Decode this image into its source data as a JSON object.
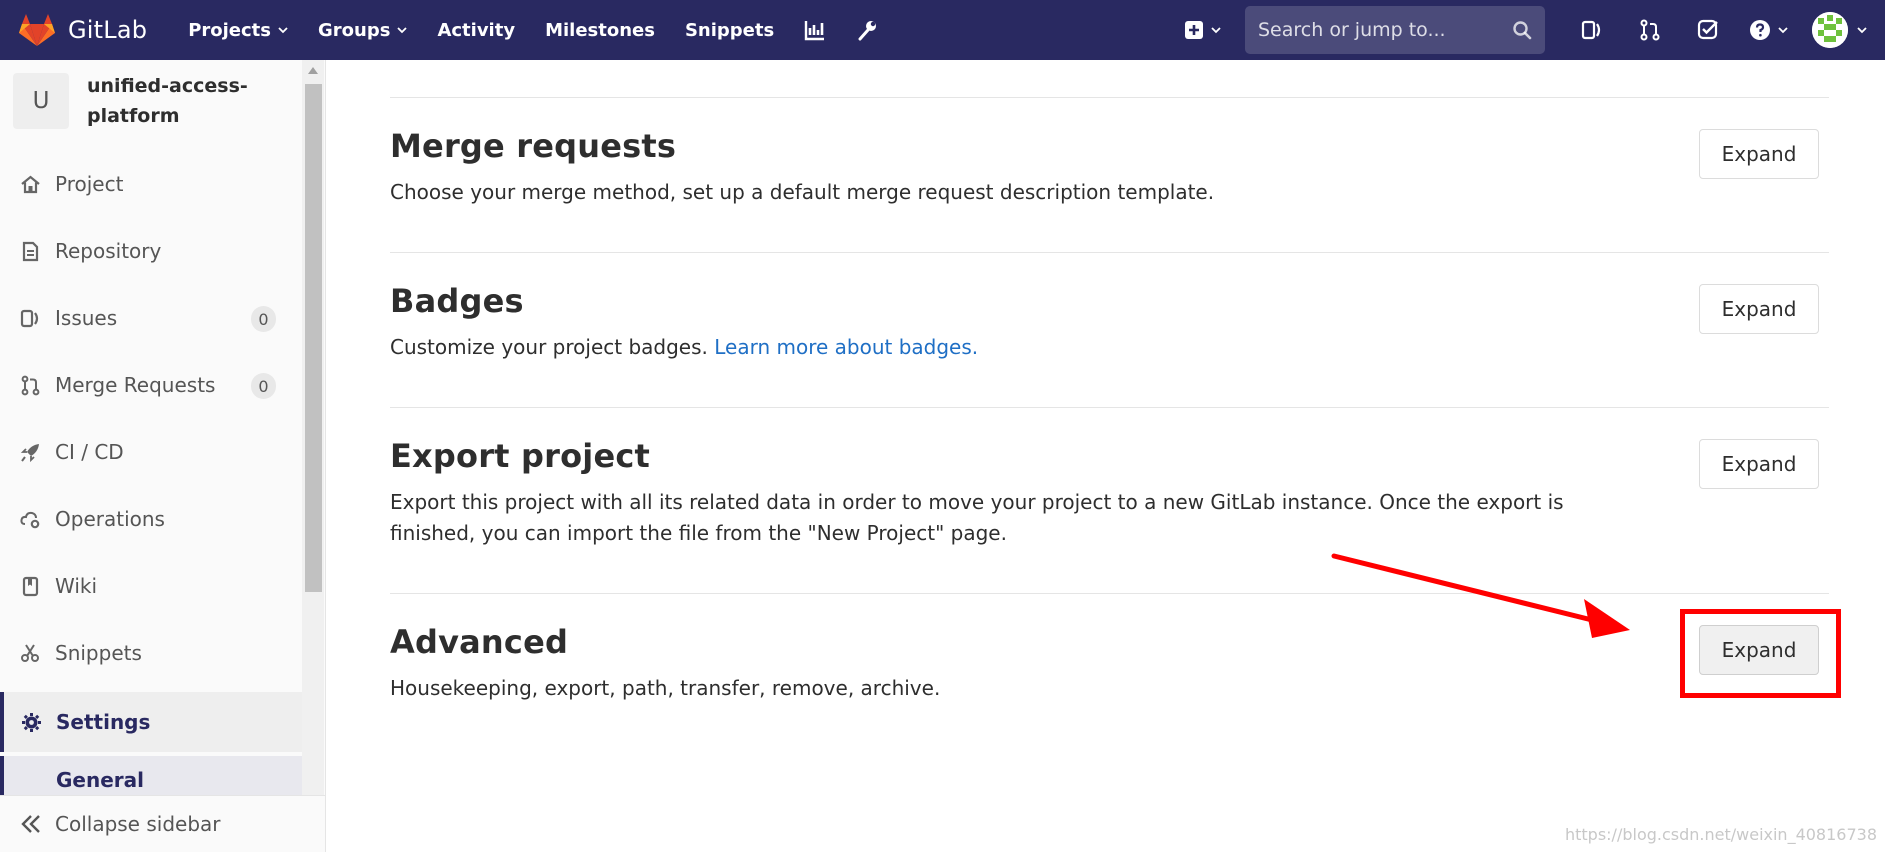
{
  "navbar": {
    "brand": "GitLab",
    "items": [
      {
        "label": "Projects",
        "has_caret": true
      },
      {
        "label": "Groups",
        "has_caret": true
      },
      {
        "label": "Activity",
        "has_caret": false
      },
      {
        "label": "Milestones",
        "has_caret": false
      },
      {
        "label": "Snippets",
        "has_caret": false
      }
    ],
    "icons": [
      "chart-icon",
      "wrench-icon"
    ],
    "search_placeholder": "Search or jump to...",
    "right_icons": [
      "issues-icon",
      "merge-request-icon",
      "todo-icon"
    ],
    "bg_color": "#292961"
  },
  "sidebar": {
    "project_initial": "U",
    "project_name": "unified-access-platform",
    "items": [
      {
        "label": "Project",
        "icon": "home-icon"
      },
      {
        "label": "Repository",
        "icon": "doc-icon"
      },
      {
        "label": "Issues",
        "icon": "issues-icon",
        "badge": "0"
      },
      {
        "label": "Merge Requests",
        "icon": "merge-request-icon",
        "badge": "0"
      },
      {
        "label": "CI / CD",
        "icon": "rocket-icon"
      },
      {
        "label": "Operations",
        "icon": "cloud-gear-icon"
      },
      {
        "label": "Wiki",
        "icon": "book-icon"
      },
      {
        "label": "Snippets",
        "icon": "scissors-icon"
      },
      {
        "label": "Settings",
        "icon": "gear-icon",
        "active": true
      }
    ],
    "sub_item": "General",
    "collapse_label": "Collapse sidebar"
  },
  "sections": [
    {
      "title": "Merge requests",
      "description": "Choose your merge method, set up a default merge request description template.",
      "button": "Expand"
    },
    {
      "title": "Badges",
      "description": "Customize your project badges. ",
      "link": "Learn more about badges.",
      "button": "Expand"
    },
    {
      "title": "Export project",
      "description": "Export this project with all its related data in order to move your project to a new GitLab instance. Once the export is finished, you can import the file from the \"New Project\" page.",
      "button": "Expand"
    },
    {
      "title": "Advanced",
      "description": "Housekeeping, export, path, transfer, remove, archive.",
      "button": "Expand",
      "highlighted": true
    }
  ],
  "annotation": {
    "color": "#ff0000"
  },
  "watermark": "https://blog.csdn.net/weixin_40816738"
}
